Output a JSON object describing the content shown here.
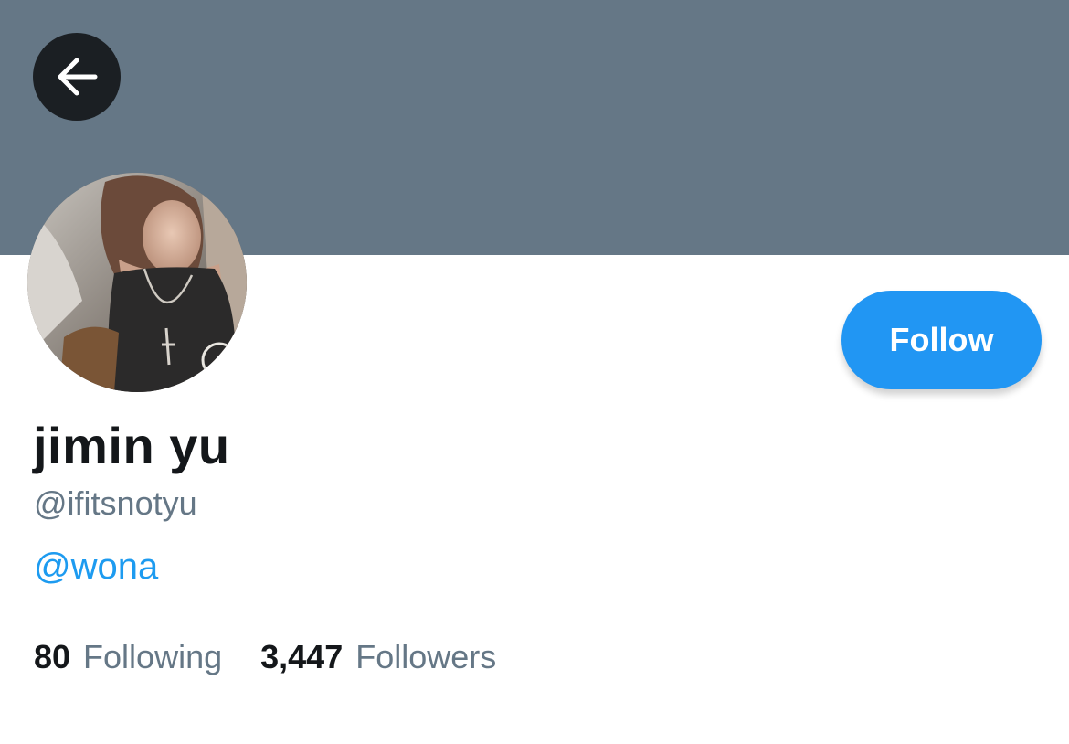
{
  "colors": {
    "banner": "#657786",
    "accent": "#1d9bf0",
    "follow_button": "#2196f3",
    "text_primary": "#14171a",
    "text_secondary": "#657786"
  },
  "header": {
    "back_icon": "arrow-left-icon"
  },
  "profile": {
    "avatar": "profile-photo",
    "display_name": "jimin yu",
    "handle": "@ifitsnotyu",
    "bio_mention": "@wona",
    "follow_label": "Follow"
  },
  "stats": {
    "following_count": "80",
    "following_label": "Following",
    "followers_count": "3,447",
    "followers_label": "Followers"
  }
}
